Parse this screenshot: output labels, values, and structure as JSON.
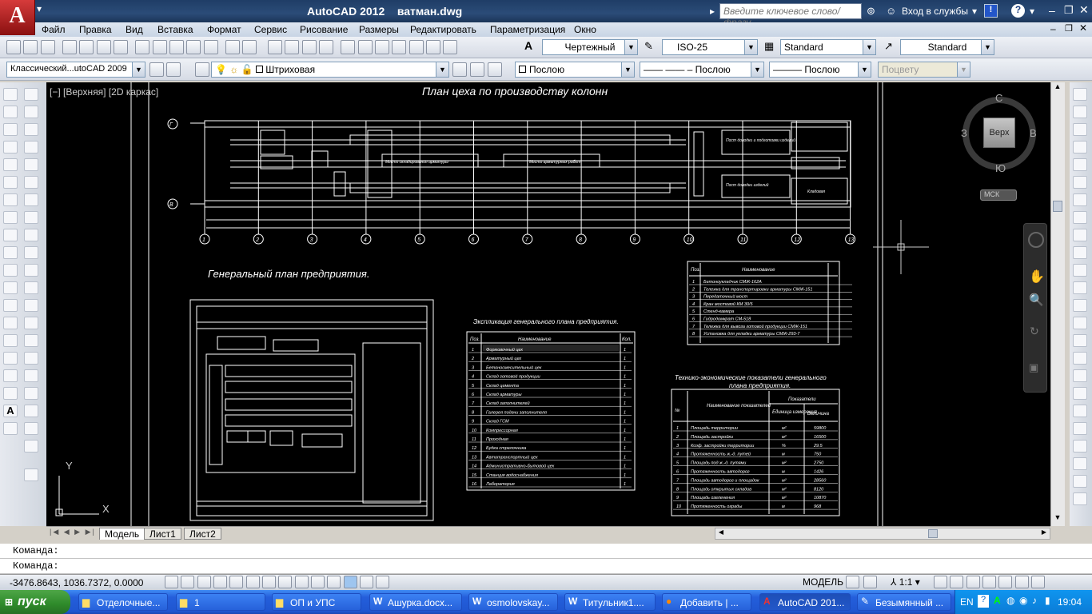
{
  "app": {
    "title": "AutoCAD 2012",
    "file": "ватман.dwg",
    "logo": "A"
  },
  "titlebar": {
    "search_placeholder": "Введите ключевое слово/фразу",
    "login": "Вход в службы",
    "help": "?"
  },
  "menu": [
    "Файл",
    "Правка",
    "Вид",
    "Вставка",
    "Формат",
    "Сервис",
    "Рисование",
    "Размеры",
    "Редактировать",
    "Параметризация",
    "Окно"
  ],
  "toolbar2": {
    "text_style": "Чертежный",
    "dim_style": "ISO-25",
    "table_style": "Standard",
    "mleader_style": "Standard"
  },
  "toolbar3": {
    "workspace": "Классический...utoCAD 2009",
    "layer": "Штриховая",
    "color": "Послою",
    "linetype": "—— —— – Послою",
    "lineweight": "——— Послою",
    "plotstyle": "Поцвету"
  },
  "viewport": {
    "label": "[−] [Верхняя] [2D каркас]"
  },
  "drawing": {
    "title_top": "План цеха по производству колонн",
    "title_genplan": "Генеральный план предприятия.",
    "title_expl": "Экспликация генерального плана предприятия.",
    "title_tep1": "Технико-экономические показатели генерального",
    "title_tep2": "плана предприятия.",
    "zone1": "Место складирования арматуры",
    "zone2": "Место арматурных работ",
    "zone3": "Пост доводки и подготовки изделий",
    "zone4": "Пост доводки изделий",
    "zone5": "Кладовая",
    "axes": [
      "1",
      "2",
      "3",
      "4",
      "5",
      "6",
      "7",
      "8",
      "9",
      "10",
      "11",
      "12",
      "13"
    ],
    "rows": [
      "Г",
      "В"
    ],
    "expl_table": {
      "headers": [
        "Поз.",
        "Наименование",
        "Кол."
      ],
      "rows": [
        [
          "1",
          "Формовочный цех",
          "1"
        ],
        [
          "2",
          "Арматурный цех",
          "1"
        ],
        [
          "3",
          "Бетоносмесительный цех",
          "1"
        ],
        [
          "4",
          "Склад готовой продукции",
          "1"
        ],
        [
          "5",
          "Склад цемента",
          "1"
        ],
        [
          "6",
          "Склад арматуры",
          "1"
        ],
        [
          "7",
          "Склад заполнителей",
          "1"
        ],
        [
          "8",
          "Галерея подачи заполнителя",
          "1"
        ],
        [
          "9",
          "Склад ГСМ",
          "1"
        ],
        [
          "10",
          "Компрессорная",
          "1"
        ],
        [
          "11",
          "Проходная",
          "1"
        ],
        [
          "12",
          "Будка стрелочника",
          "1"
        ],
        [
          "13",
          "Автотранспортный цех",
          "1"
        ],
        [
          "14",
          "Административно-бытовой цех",
          "1"
        ],
        [
          "15",
          "Станция водоснабжения",
          "1"
        ],
        [
          "16",
          "Лаборатория",
          "1"
        ]
      ]
    },
    "equip_table": {
      "headers": [
        "Поз.",
        "Наименование"
      ],
      "rows": [
        [
          "1",
          "Бетоноукладчик СМЖ-162А"
        ],
        [
          "2",
          "Тележка для транспортировки арматуры СМЖ-151"
        ],
        [
          "3",
          "Передаточный мост"
        ],
        [
          "4",
          "Кран мостовой КМ 30/5"
        ],
        [
          "5",
          "Стенд-камера"
        ],
        [
          "6",
          "Гидродомкрат СМ-518"
        ],
        [
          "7",
          "Тележка для вывоза готовой продукции СМЖ-151"
        ],
        [
          "8",
          "Установка для укладки арматуры СМЖ-293-7"
        ]
      ]
    },
    "tep_table": {
      "headers": [
        "№",
        "Наименование показателей",
        "Показатели",
        "Единица измерения",
        "Величина"
      ],
      "rows": [
        [
          "1",
          "Площадь территории",
          "м²",
          "59800"
        ],
        [
          "2",
          "Площадь застройки",
          "м²",
          "16500"
        ],
        [
          "3",
          "Коэф. застройки территории",
          "%",
          "29.5"
        ],
        [
          "4",
          "Протяженность ж.-д. путей",
          "м",
          "750"
        ],
        [
          "5",
          "Площадь под ж.-д. путями",
          "м²",
          "2750"
        ],
        [
          "6",
          "Протяженность автодорог",
          "м",
          "1426"
        ],
        [
          "7",
          "Площадь автодорог и площадок",
          "м²",
          "28560"
        ],
        [
          "8",
          "Площадь открытых складов",
          "м²",
          "8120"
        ],
        [
          "9",
          "Площадь озеленения",
          "м²",
          "10870"
        ],
        [
          "10",
          "Протяженность ограды",
          "м",
          "968"
        ]
      ]
    }
  },
  "viewcube": {
    "north": "С",
    "south": "Ю",
    "west": "З",
    "east": "В",
    "top": "Верх",
    "ucs": "МСК"
  },
  "ucs_icon": {
    "x": "X",
    "y": "Y"
  },
  "layout_tabs": [
    "Модель",
    "Лист1",
    "Лист2"
  ],
  "command": {
    "line1": "Команда:",
    "line2": "Команда:"
  },
  "status": {
    "coords": "-3476.8643, 1036.7372, 0.0000",
    "model": "МОДЕЛЬ",
    "scale": "1:1"
  },
  "taskbar": {
    "start": "пуск",
    "items": [
      "Отделочные...",
      "1",
      "ОП и УПС",
      "Ашурка.docx...",
      "osmolovskay...",
      "Титульник1....",
      "Добавить | ...",
      "AutoCAD 201...",
      "Безымянный ..."
    ],
    "lang": "EN",
    "time": "19:04"
  }
}
